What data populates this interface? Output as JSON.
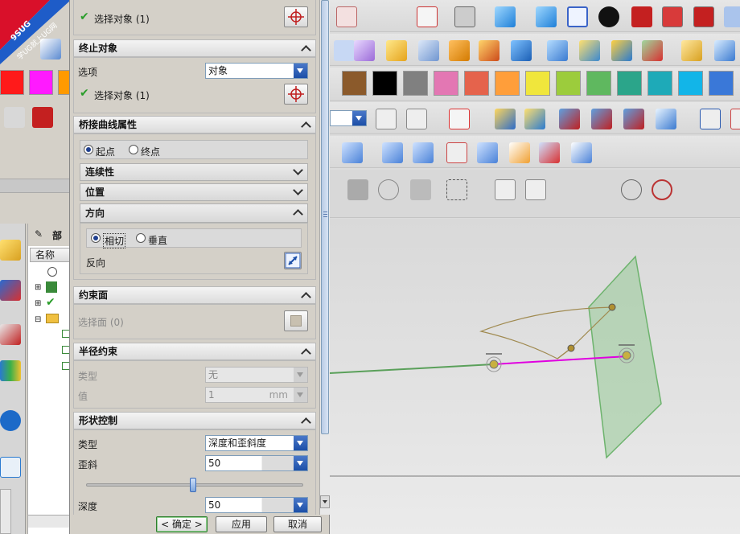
{
  "dialog": {
    "top_select_label": "选择对象 (1)",
    "end_object": {
      "header": "终止对象",
      "option_label": "选项",
      "option_value": "对象",
      "select_label": "选择对象 (1)"
    },
    "bridge_props": {
      "header": "桥接曲线属性",
      "radio_start": "起点",
      "radio_end": "终点",
      "continuity": "连续性",
      "position": "位置",
      "direction": {
        "header": "方向",
        "radio_tangent": "相切",
        "radio_perpendicular": "垂直",
        "reverse_label": "反向"
      }
    },
    "constraint_face": {
      "header": "约束面",
      "select_label": "选择面 (0)"
    },
    "radius_constraint": {
      "header": "半径约束",
      "type_label": "类型",
      "type_value": "无",
      "value_label": "值",
      "value_value": "1",
      "unit": "mm"
    },
    "shape_control": {
      "header": "形状控制",
      "type_label": "类型",
      "type_value": "深度和歪斜度",
      "skew_label": "歪斜",
      "skew_value": "50",
      "skew_slider_fraction": 0.49,
      "depth_label": "深度",
      "depth_value": "50"
    },
    "buttons": {
      "ok": "< 确定 >",
      "apply": "应用",
      "cancel": "取消"
    }
  },
  "navigator": {
    "title": "部",
    "column_name": "名称"
  },
  "watermark": {
    "line1": "9SUG",
    "line2": "学UG就上UG网"
  },
  "swatches": [
    "#8b5a2b",
    "#000000",
    "#808080",
    "#e377b3",
    "#e5634c",
    "#ff9e3a",
    "#f0e63c",
    "#9ccc3c",
    "#5fb85f",
    "#2ba58a",
    "#1eaab8",
    "#12b5e8",
    "#3a78d8"
  ],
  "left_swatches": [
    "#ff1a1a",
    "#ff1aff",
    "#ff9a00"
  ],
  "colors": {
    "accent_blue": "#1c4fa8",
    "check_green": "#2a9d2a",
    "curve_magenta": "#e000e0",
    "plane_green": "#8fc88f"
  }
}
